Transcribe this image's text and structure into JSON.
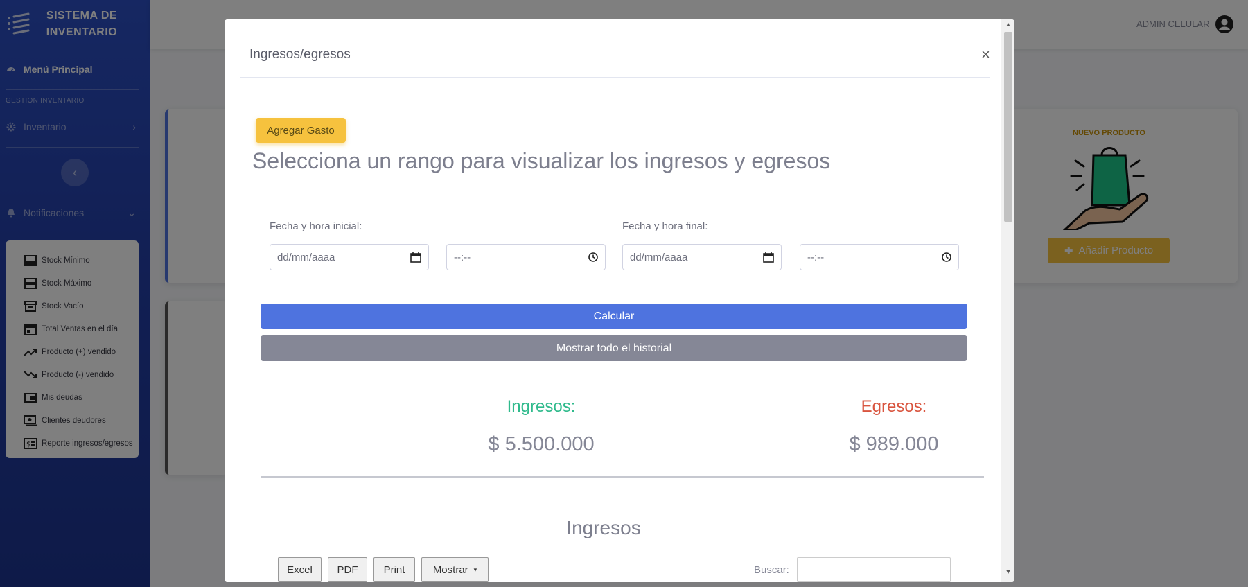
{
  "sidebar": {
    "brand": "SISTEMA DE INVENTARIO",
    "menu_principal": "Menú Principal",
    "heading": "GESTION INVENTARIO",
    "inventario": "Inventario",
    "toggle_icon": "chevron-left-icon",
    "notificaciones": "Notificaciones",
    "collapse_items": [
      {
        "label": "Stock Mínimo",
        "icon": "inbox-icon"
      },
      {
        "label": "Stock Máximo",
        "icon": "inbox-stack-icon"
      },
      {
        "label": "Stock Vacío",
        "icon": "archive-icon"
      },
      {
        "label": "Total Ventas en el día",
        "icon": "calendar-icon"
      },
      {
        "label": "Producto (+) vendido",
        "icon": "trending-up-icon"
      },
      {
        "label": "Producto (-) vendido",
        "icon": "trending-down-icon"
      },
      {
        "label": "Mis deudas",
        "icon": "wallet-icon"
      },
      {
        "label": "Clientes deudores",
        "icon": "money-bill-icon"
      },
      {
        "label": "Reporte ingresos/egresos",
        "icon": "money-report-icon"
      }
    ]
  },
  "topbar": {
    "user_name": "ADMIN CELULAR"
  },
  "background": {
    "new_product_title": "NUEVO PRODUCTO",
    "add_product_label": "Añadir Producto"
  },
  "modal": {
    "title": "Ingresos/egresos",
    "close_label": "×",
    "add_expense_label": "Agregar Gasto",
    "range_title": "Selecciona un rango para visualizar los ingresos y egresos",
    "start_label": "Fecha y hora inicial:",
    "end_label": "Fecha y hora final:",
    "date_placeholder": "dd/mm/aaaa",
    "time_placeholder": "--:--",
    "calc_label": "Calcular",
    "history_label": "Mostrar todo el historial",
    "income_label": "Ingresos:",
    "income_value": "$ 5.500.000",
    "expense_label": "Egresos:",
    "expense_value": "$ 989.000",
    "section_title": "Ingresos",
    "table_buttons": {
      "excel": "Excel",
      "pdf": "PDF",
      "print": "Print",
      "show": "Mostrar"
    },
    "search_label": "Buscar:"
  },
  "colors": {
    "primary": "#4e73df",
    "warning": "#f6c23e",
    "secondary": "#858796",
    "income": "#1cc88a",
    "expense": "#e74a3b"
  }
}
